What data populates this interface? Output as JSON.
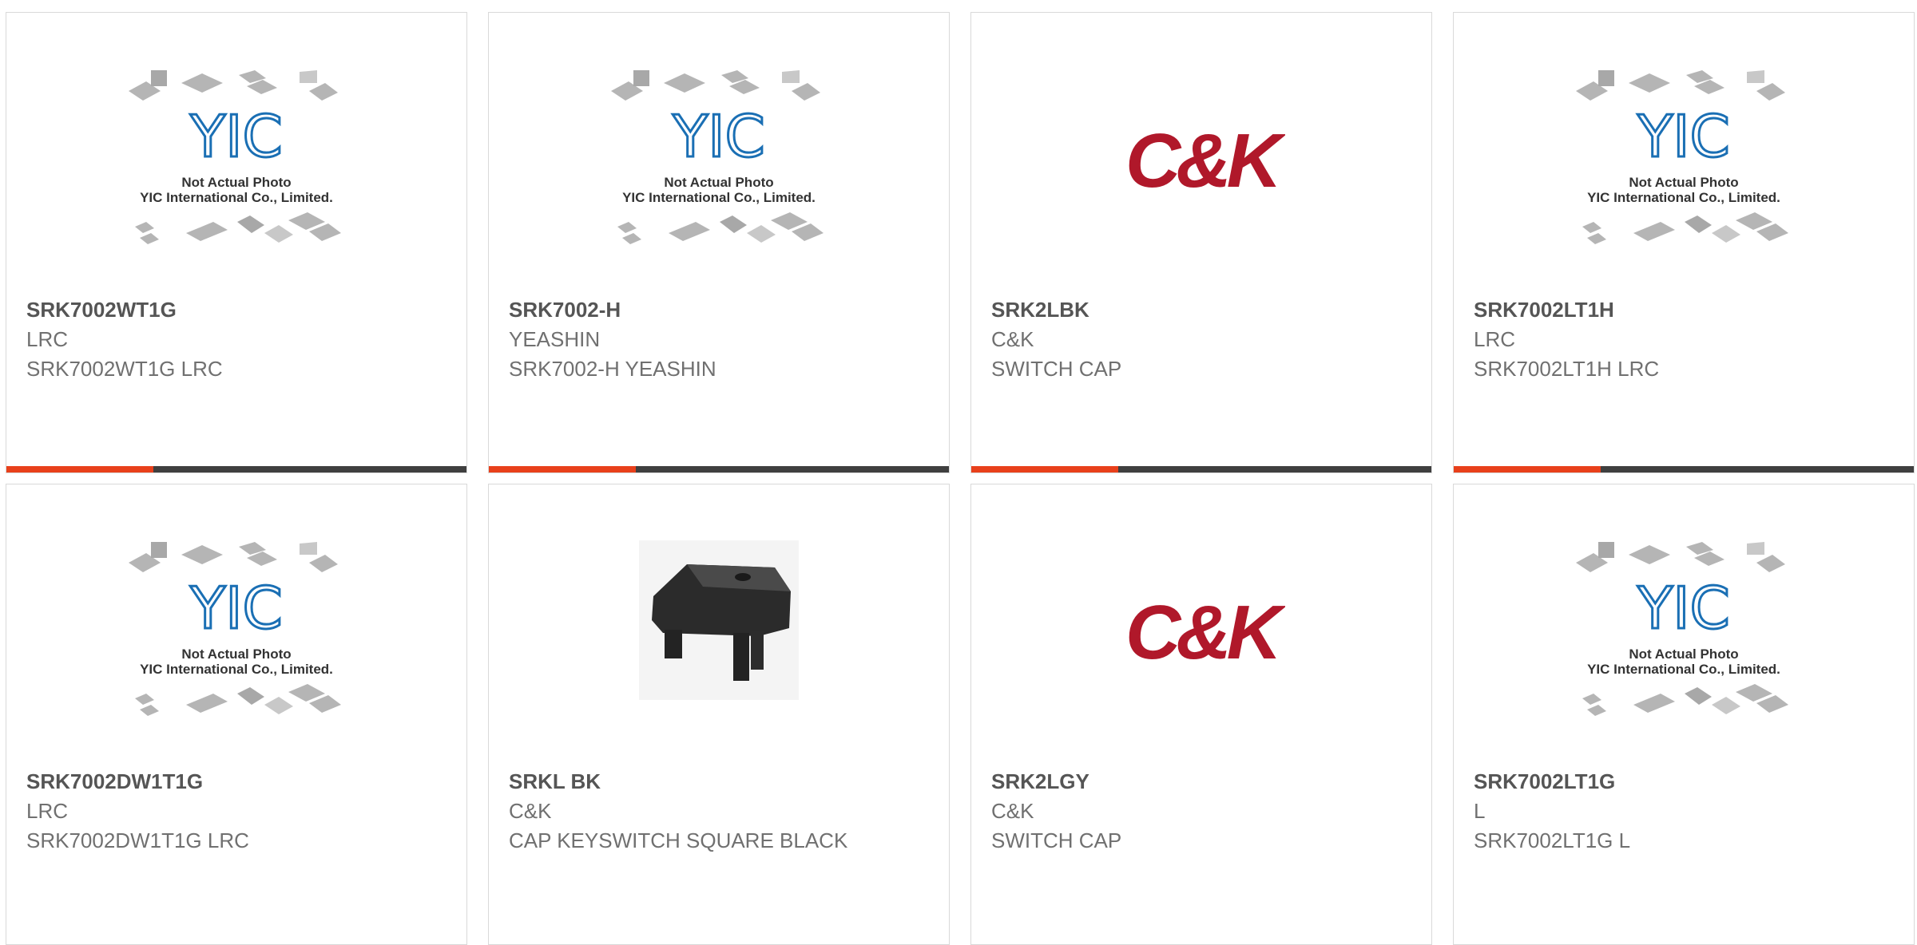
{
  "colors": {
    "accent": "#e8401b",
    "bar_dark": "#3f3f3f",
    "yic_blue": "#1a6fb4",
    "ck_red": "#b0182a"
  },
  "placeholder": {
    "line1": "Not Actual Photo",
    "line2": "YIC International Co., Limited.",
    "logo_text": "YIC"
  },
  "brand_ck": {
    "logo_text": "C&K"
  },
  "products": [
    {
      "part": "SRK7002WT1G",
      "mfr": "LRC",
      "desc": "SRK7002WT1G LRC",
      "image": "yic-placeholder"
    },
    {
      "part": "SRK7002-H",
      "mfr": "YEASHIN",
      "desc": "SRK7002-H YEASHIN",
      "image": "yic-placeholder"
    },
    {
      "part": "SRK2LBK",
      "mfr": "C&K",
      "desc": "SWITCH CAP",
      "image": "ck-logo"
    },
    {
      "part": "SRK7002LT1H",
      "mfr": "LRC",
      "desc": "SRK7002LT1H LRC",
      "image": "yic-placeholder"
    },
    {
      "part": "SRK7002DW1T1G",
      "mfr": "LRC",
      "desc": "SRK7002DW1T1G LRC",
      "image": "yic-placeholder"
    },
    {
      "part": "SRKL BK",
      "mfr": "C&K",
      "desc": "CAP KEYSWITCH SQUARE BLACK",
      "image": "keycap-photo"
    },
    {
      "part": "SRK2LGY",
      "mfr": "C&K",
      "desc": "SWITCH CAP",
      "image": "ck-logo"
    },
    {
      "part": "SRK7002LT1G",
      "mfr": "L",
      "desc": "SRK7002LT1G L",
      "image": "yic-placeholder"
    }
  ]
}
